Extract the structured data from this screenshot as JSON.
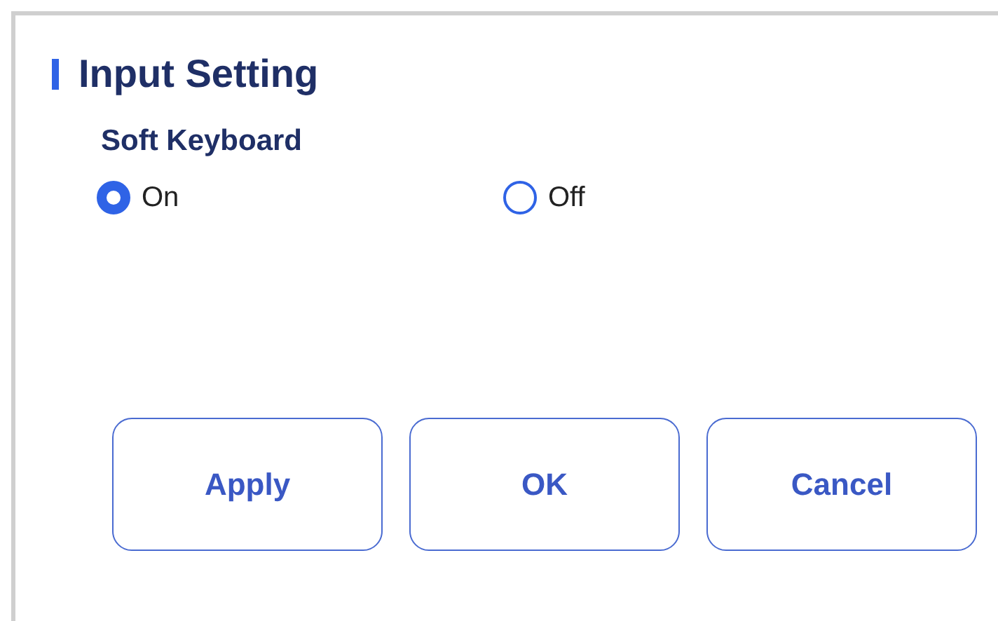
{
  "title": "Input Setting",
  "section": {
    "label": "Soft Keyboard",
    "options": [
      {
        "label": "On",
        "selected": true
      },
      {
        "label": "Off",
        "selected": false
      }
    ]
  },
  "buttons": [
    "Apply",
    "OK",
    "Cancel"
  ]
}
